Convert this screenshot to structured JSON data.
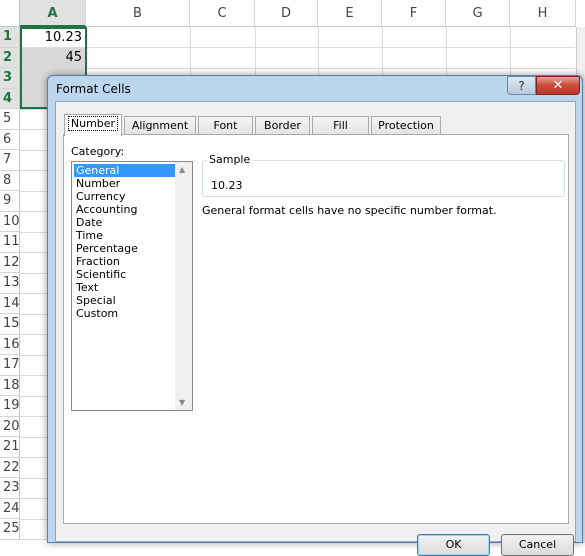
{
  "sheet": {
    "columns": [
      "A",
      "B",
      "C",
      "D",
      "E",
      "F",
      "G",
      "H"
    ],
    "rows": [
      "1",
      "2",
      "3",
      "4",
      "5",
      "6",
      "7",
      "8",
      "9",
      "10",
      "11",
      "12",
      "13",
      "14",
      "15",
      "16",
      "17",
      "18",
      "19",
      "20",
      "21",
      "22",
      "23",
      "24",
      "25"
    ],
    "cells": {
      "A1": "10.23",
      "A2": "45"
    },
    "accent": "#217346"
  },
  "dialog": {
    "title": "Format Cells",
    "help_label": "?",
    "close_label": "✕",
    "tabs": [
      "Number",
      "Alignment",
      "Font",
      "Border",
      "Fill",
      "Protection"
    ],
    "active_tab": "Number",
    "category_label": "Category:",
    "categories": [
      "General",
      "Number",
      "Currency",
      "Accounting",
      "Date",
      "Time",
      "Percentage",
      "Fraction",
      "Scientific",
      "Text",
      "Special",
      "Custom"
    ],
    "selected_category": "General",
    "sample_label": "Sample",
    "sample_value": "10.23",
    "description": "General format cells have no specific number format.",
    "ok_label": "OK",
    "cancel_label": "Cancel",
    "selection_color": "#3399ff"
  }
}
